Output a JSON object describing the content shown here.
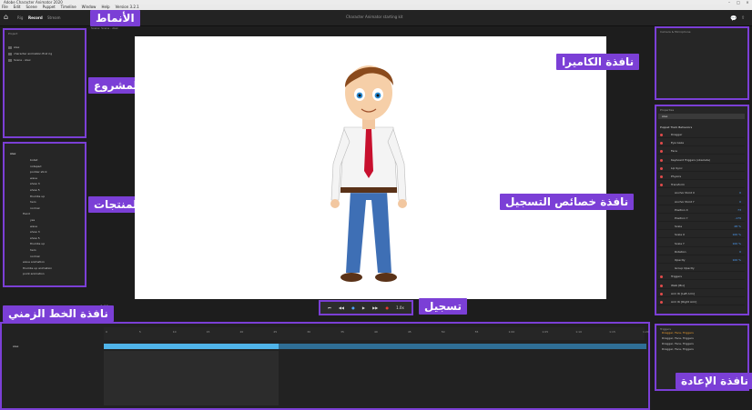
{
  "app": {
    "title": "Adobe Character Animator 2020",
    "menu": [
      "File",
      "Edit",
      "Scene",
      "Puppet",
      "Timeline",
      "Window",
      "Help",
      "Version 3.2.1"
    ],
    "modes": [
      "Rig",
      "Record",
      "Stream"
    ],
    "active_mode": "Record",
    "document_title": "Character Animator starting kit"
  },
  "labels": {
    "modes": "الأنماط",
    "project": "المشروع",
    "products": "المنتجات",
    "camera": "نافذة الكاميرا",
    "properties": "نافذة خصائص التسجيل",
    "record": "تسجيل",
    "timeline": "نافذة الخط الزمني",
    "replay": "نافذة الإعادة"
  },
  "project": {
    "tab": "Project",
    "items": [
      "Alex",
      "character animation first rig",
      "Scene - Alex"
    ]
  },
  "triggers": {
    "header": "Alex",
    "items": [
      "bobst",
      "notepad",
      "pointer stick",
      "wave",
      "show 3",
      "show 5",
      "thumbs up",
      "hero",
      "normal",
      "Hand",
      "yes",
      "wave",
      "show 3",
      "show 5",
      "thumbs up",
      "hero",
      "normal",
      "wave animation",
      "thumbs up animation",
      "point animation"
    ]
  },
  "scene": {
    "tab": "Scene: Scene - Alex",
    "timecode": "0:00"
  },
  "camera": {
    "tab": "Camera & Microphone"
  },
  "properties": {
    "tab": "Properties",
    "puppet": "Alex",
    "section": "Puppet Track Behaviors",
    "rows": [
      {
        "name": "Dragger",
        "val": ""
      },
      {
        "name": "Eye Gaze",
        "val": ""
      },
      {
        "name": "Face",
        "val": ""
      },
      {
        "name": "Keyboard Triggers (obsolete)",
        "val": ""
      },
      {
        "name": "Lip Sync",
        "val": ""
      },
      {
        "name": "Physics",
        "val": ""
      },
      {
        "name": "Transform",
        "val": ""
      },
      {
        "name": "Anchor Point X",
        "val": "0"
      },
      {
        "name": "Anchor Point Y",
        "val": "0"
      },
      {
        "name": "Position X",
        "val": "73"
      },
      {
        "name": "Position Y",
        "val": "-179"
      },
      {
        "name": "Scale",
        "val": "28 %"
      },
      {
        "name": "Scale X",
        "val": "100 %"
      },
      {
        "name": "Scale Y",
        "val": "100 %"
      },
      {
        "name": "Rotation",
        "val": "0"
      },
      {
        "name": "Opacity",
        "val": "100 %"
      },
      {
        "name": "Group Opacity",
        "val": ""
      },
      {
        "name": "Triggers",
        "val": ""
      },
      {
        "name": "Walk [Bio]",
        "val": ""
      },
      {
        "name": "Arm IK [Left Arm]",
        "val": ""
      },
      {
        "name": "Arm IK [Right Arm]",
        "val": ""
      }
    ]
  },
  "replay": {
    "tab": "Triggers",
    "items": [
      "Dragger, Face, Triggers",
      "Dragger, Face, Triggers",
      "Dragger, Face, Triggers",
      "Dragger, Face, Triggers"
    ]
  },
  "timeline": {
    "track": "Alex",
    "ticks": [
      "0",
      "5",
      "10",
      "15",
      "20",
      "25",
      "30",
      "35",
      "40",
      "45",
      "50",
      "55",
      "1:00",
      "1:05",
      "1:10",
      "1:15",
      "1:20"
    ]
  },
  "colors": {
    "accent": "#7b3fd6",
    "track": "#4fb3e8",
    "record": "#e53935"
  }
}
